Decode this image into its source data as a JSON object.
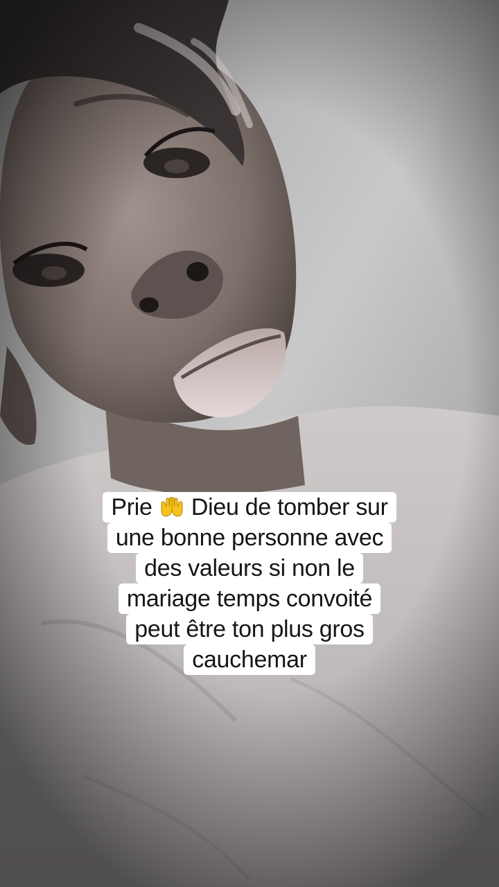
{
  "caption": {
    "prefix": "Prie",
    "icon": "palms-up-together-icon",
    "line1_rest": "Dieu de tomber sur",
    "line2": "une bonne personne avec",
    "line3": "des valeurs si non le",
    "line4": "mariage temps convoité",
    "line5": "peut être ton plus gros",
    "line6": "cauchemar"
  },
  "colors": {
    "caption_background": "#ffffff",
    "caption_text": "#161616",
    "emoji_yellow": "#f6c21c"
  }
}
